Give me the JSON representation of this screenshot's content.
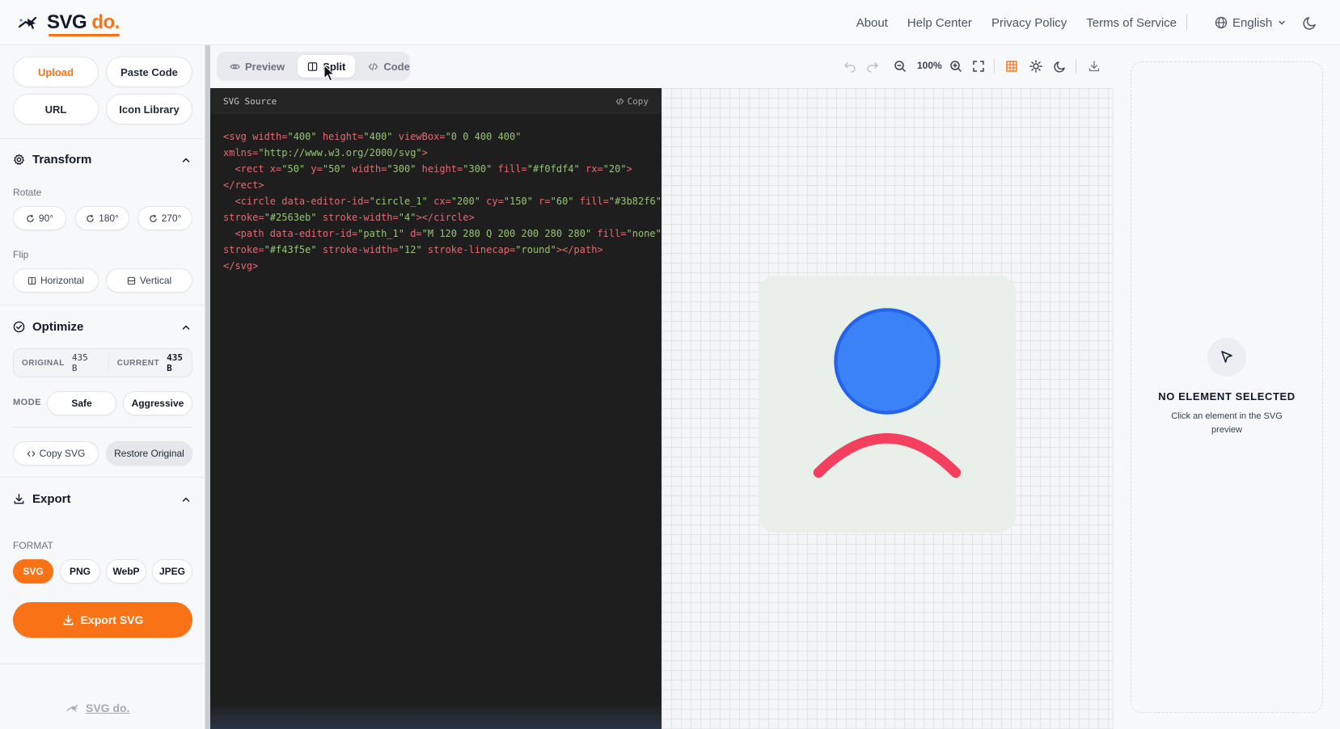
{
  "app": {
    "logo_main": "SVG",
    "logo_accent": "do."
  },
  "nav": {
    "about": "About",
    "help": "Help Center",
    "privacy": "Privacy Policy",
    "terms": "Terms of Service",
    "language": "English"
  },
  "sidebar": {
    "upload": "Upload",
    "paste_code": "Paste Code",
    "url": "URL",
    "icon_library": "Icon Library",
    "transform": {
      "title": "Transform",
      "rotate_label": "Rotate",
      "rotate_90": "90°",
      "rotate_180": "180°",
      "rotate_270": "270°",
      "flip_label": "Flip",
      "flip_horizontal": "Horizontal",
      "flip_vertical": "Vertical"
    },
    "optimize": {
      "title": "Optimize",
      "original_label": "ORIGINAL",
      "original_value": "435 B",
      "current_label": "CURRENT",
      "current_value": "435 B",
      "mode_label": "MODE",
      "mode_safe": "Safe",
      "mode_aggressive": "Aggressive",
      "copy_svg": "Copy SVG",
      "restore_original": "Restore Original"
    },
    "export": {
      "title": "Export",
      "format_label": "FORMAT",
      "formats": [
        "SVG",
        "PNG",
        "WebP",
        "JPEG"
      ],
      "selected_format": "SVG",
      "export_button": "Export SVG"
    },
    "footer_logo": "SVG do."
  },
  "toolbar": {
    "tab_preview": "Preview",
    "tab_split": "Split",
    "tab_code": "Code",
    "active_tab": "Split",
    "zoom": "100%"
  },
  "code": {
    "header": "SVG Source",
    "copy": "Copy"
  },
  "inspector": {
    "title": "NO ELEMENT SELECTED",
    "description": "Click an element in the SVG preview"
  },
  "colors": {
    "accent": "#f97316",
    "rect_fill": "#f0fdf4",
    "circle_fill": "#3b82f6",
    "circle_stroke": "#2563eb",
    "path_stroke": "#f43f5e",
    "code_bg": "#1e1e1e"
  }
}
